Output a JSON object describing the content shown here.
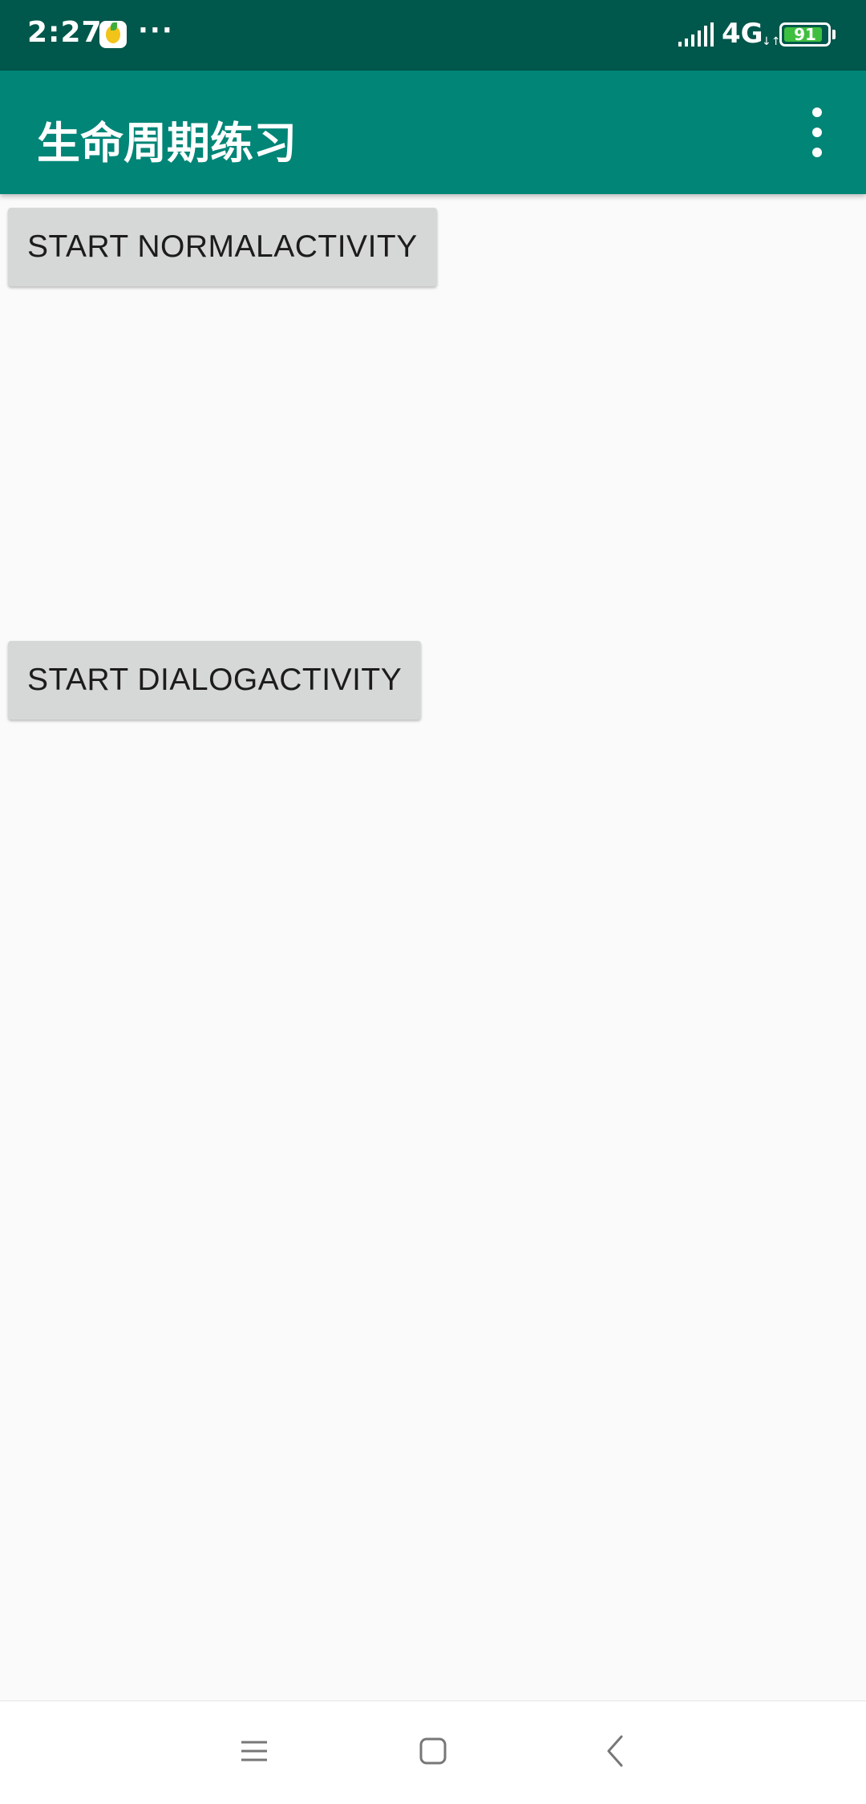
{
  "status_bar": {
    "time": "2:27",
    "more": "···",
    "network": "4G",
    "network_arrows": "↓↑",
    "battery_level": "91",
    "battery_fraction": 0.91,
    "icons": [
      "app-notification-icon",
      "signal-icon",
      "battery-icon"
    ]
  },
  "app_bar": {
    "title": "生命周期练习",
    "overflow_icon": "overflow-menu-icon"
  },
  "buttons": {
    "normal": "START NORMALACTIVITY",
    "dialog": "START DIALOGACTIVITY"
  },
  "nav_bar": {
    "icons": [
      "menu-icon",
      "home-icon",
      "back-icon"
    ]
  },
  "colors": {
    "status_bar": "#00574b",
    "app_bar": "#008577",
    "background": "#fafafa",
    "button": "#d6d7d7",
    "battery_fill": "#3fbf3f"
  }
}
